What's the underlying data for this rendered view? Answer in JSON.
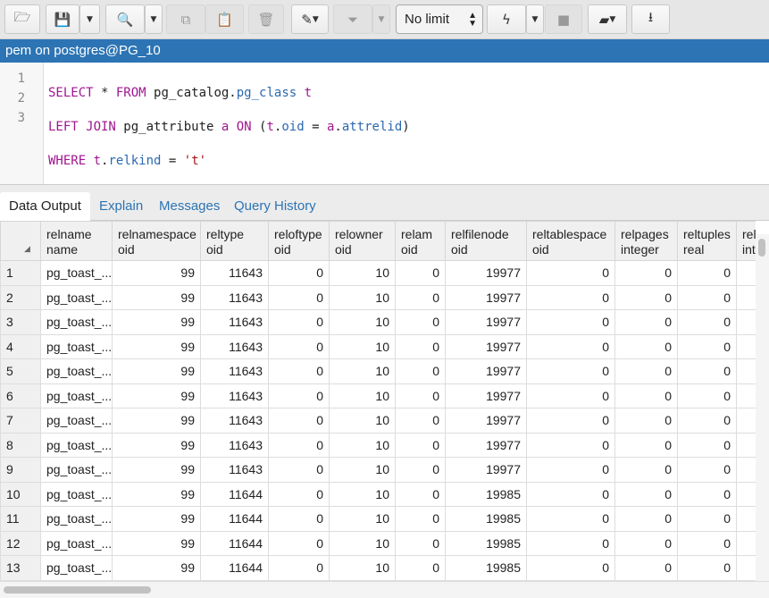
{
  "toolbar": {
    "buttons": [
      {
        "name": "open-file-button",
        "icon": "folder-open-icon",
        "glyph": "🗁"
      },
      {
        "name": "save-button",
        "icon": "save-icon",
        "glyph": "💾"
      },
      {
        "name": "find-button",
        "icon": "search-icon",
        "glyph": "🔍"
      },
      {
        "name": "copy-button",
        "icon": "copy-icon",
        "glyph": "⧉"
      },
      {
        "name": "paste-button",
        "icon": "paste-icon",
        "glyph": "📋"
      },
      {
        "name": "delete-button",
        "icon": "trash-icon",
        "glyph": "🗑"
      },
      {
        "name": "edit-button",
        "icon": "edit-icon",
        "glyph": "✎"
      },
      {
        "name": "filter-button",
        "icon": "filter-icon",
        "glyph": "⏷"
      },
      {
        "name": "execute-button",
        "icon": "bolt-icon",
        "glyph": "ϟ"
      },
      {
        "name": "stop-button",
        "icon": "stop-icon",
        "glyph": "■"
      },
      {
        "name": "clear-button",
        "icon": "eraser-icon",
        "glyph": "▰"
      },
      {
        "name": "download-button",
        "icon": "download-icon",
        "glyph": "⭳"
      }
    ],
    "row_limit": "No limit"
  },
  "title": "pem on postgres@PG_10",
  "editor": {
    "line_numbers": [
      "1",
      "2",
      "3"
    ]
  },
  "tabs": [
    {
      "label": "Data Output",
      "active": true
    },
    {
      "label": "Explain"
    },
    {
      "label": "Messages"
    },
    {
      "label": "Query History"
    }
  ],
  "grid": {
    "columns": [
      {
        "name": "relname",
        "type": "name"
      },
      {
        "name": "relnamespace",
        "type": "oid"
      },
      {
        "name": "reltype",
        "type": "oid"
      },
      {
        "name": "reloftype",
        "type": "oid"
      },
      {
        "name": "relowner",
        "type": "oid"
      },
      {
        "name": "relam",
        "type": "oid"
      },
      {
        "name": "relfilenode",
        "type": "oid"
      },
      {
        "name": "reltablespace",
        "type": "oid"
      },
      {
        "name": "relpages",
        "type": "integer"
      },
      {
        "name": "reltuples",
        "type": "real"
      },
      {
        "name": "relallvisible",
        "type": "integer"
      }
    ],
    "rows": [
      [
        "1",
        "pg_toast_...",
        "99",
        "11643",
        "0",
        "10",
        "0",
        "19977",
        "0",
        "0",
        "0",
        ""
      ],
      [
        "2",
        "pg_toast_...",
        "99",
        "11643",
        "0",
        "10",
        "0",
        "19977",
        "0",
        "0",
        "0",
        ""
      ],
      [
        "3",
        "pg_toast_...",
        "99",
        "11643",
        "0",
        "10",
        "0",
        "19977",
        "0",
        "0",
        "0",
        ""
      ],
      [
        "4",
        "pg_toast_...",
        "99",
        "11643",
        "0",
        "10",
        "0",
        "19977",
        "0",
        "0",
        "0",
        ""
      ],
      [
        "5",
        "pg_toast_...",
        "99",
        "11643",
        "0",
        "10",
        "0",
        "19977",
        "0",
        "0",
        "0",
        ""
      ],
      [
        "6",
        "pg_toast_...",
        "99",
        "11643",
        "0",
        "10",
        "0",
        "19977",
        "0",
        "0",
        "0",
        ""
      ],
      [
        "7",
        "pg_toast_...",
        "99",
        "11643",
        "0",
        "10",
        "0",
        "19977",
        "0",
        "0",
        "0",
        ""
      ],
      [
        "8",
        "pg_toast_...",
        "99",
        "11643",
        "0",
        "10",
        "0",
        "19977",
        "0",
        "0",
        "0",
        ""
      ],
      [
        "9",
        "pg_toast_...",
        "99",
        "11643",
        "0",
        "10",
        "0",
        "19977",
        "0",
        "0",
        "0",
        ""
      ],
      [
        "10",
        "pg_toast_...",
        "99",
        "11644",
        "0",
        "10",
        "0",
        "19985",
        "0",
        "0",
        "0",
        ""
      ],
      [
        "11",
        "pg_toast_...",
        "99",
        "11644",
        "0",
        "10",
        "0",
        "19985",
        "0",
        "0",
        "0",
        ""
      ],
      [
        "12",
        "pg_toast_...",
        "99",
        "11644",
        "0",
        "10",
        "0",
        "19985",
        "0",
        "0",
        "0",
        ""
      ],
      [
        "13",
        "pg_toast_...",
        "99",
        "11644",
        "0",
        "10",
        "0",
        "19985",
        "0",
        "0",
        "0",
        ""
      ]
    ]
  },
  "colors": {
    "titlebar": "#2c74b4",
    "keyword": "#a0168f",
    "identifier": "#2b68b0",
    "string": "#a31515"
  }
}
